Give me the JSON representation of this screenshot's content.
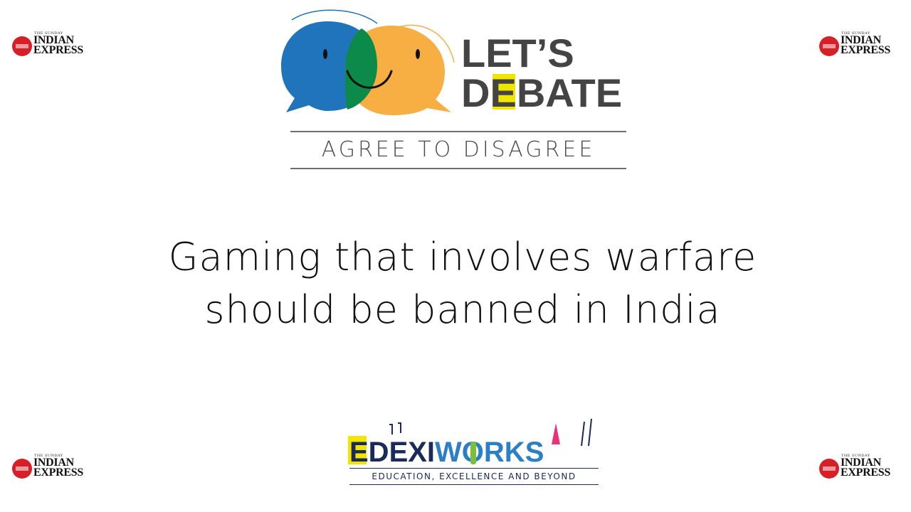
{
  "brand": {
    "masthead_small": "THE SUNDAY",
    "masthead_line1": "INDIAN",
    "masthead_line2": "EXPRESS"
  },
  "header": {
    "title_line1": "LET’S",
    "title_line2_a": "D",
    "title_line2_b": "E",
    "title_line2_c": "BATE",
    "tagline": "AGREE TO DISAGREE"
  },
  "topic": {
    "line1": "Gaming that involves warfare",
    "line2": "should be banned in India"
  },
  "footer": {
    "logo_text_a": "EDEXI",
    "logo_text_b": "WORKS",
    "tagline": "EDUCATION, EXCELLENCE AND BEYOND"
  },
  "colors": {
    "bubble_blue": "#1f74bb",
    "bubble_orange": "#f7ae43",
    "overlap_green": "#0c8a4a",
    "title_gray": "#444444",
    "highlight_yellow": "#f2e600",
    "footer_navy": "#1a2a5a",
    "footer_blue": "#2c7fc4",
    "footer_pink": "#e8337a",
    "footer_green": "#7bbf3a"
  }
}
